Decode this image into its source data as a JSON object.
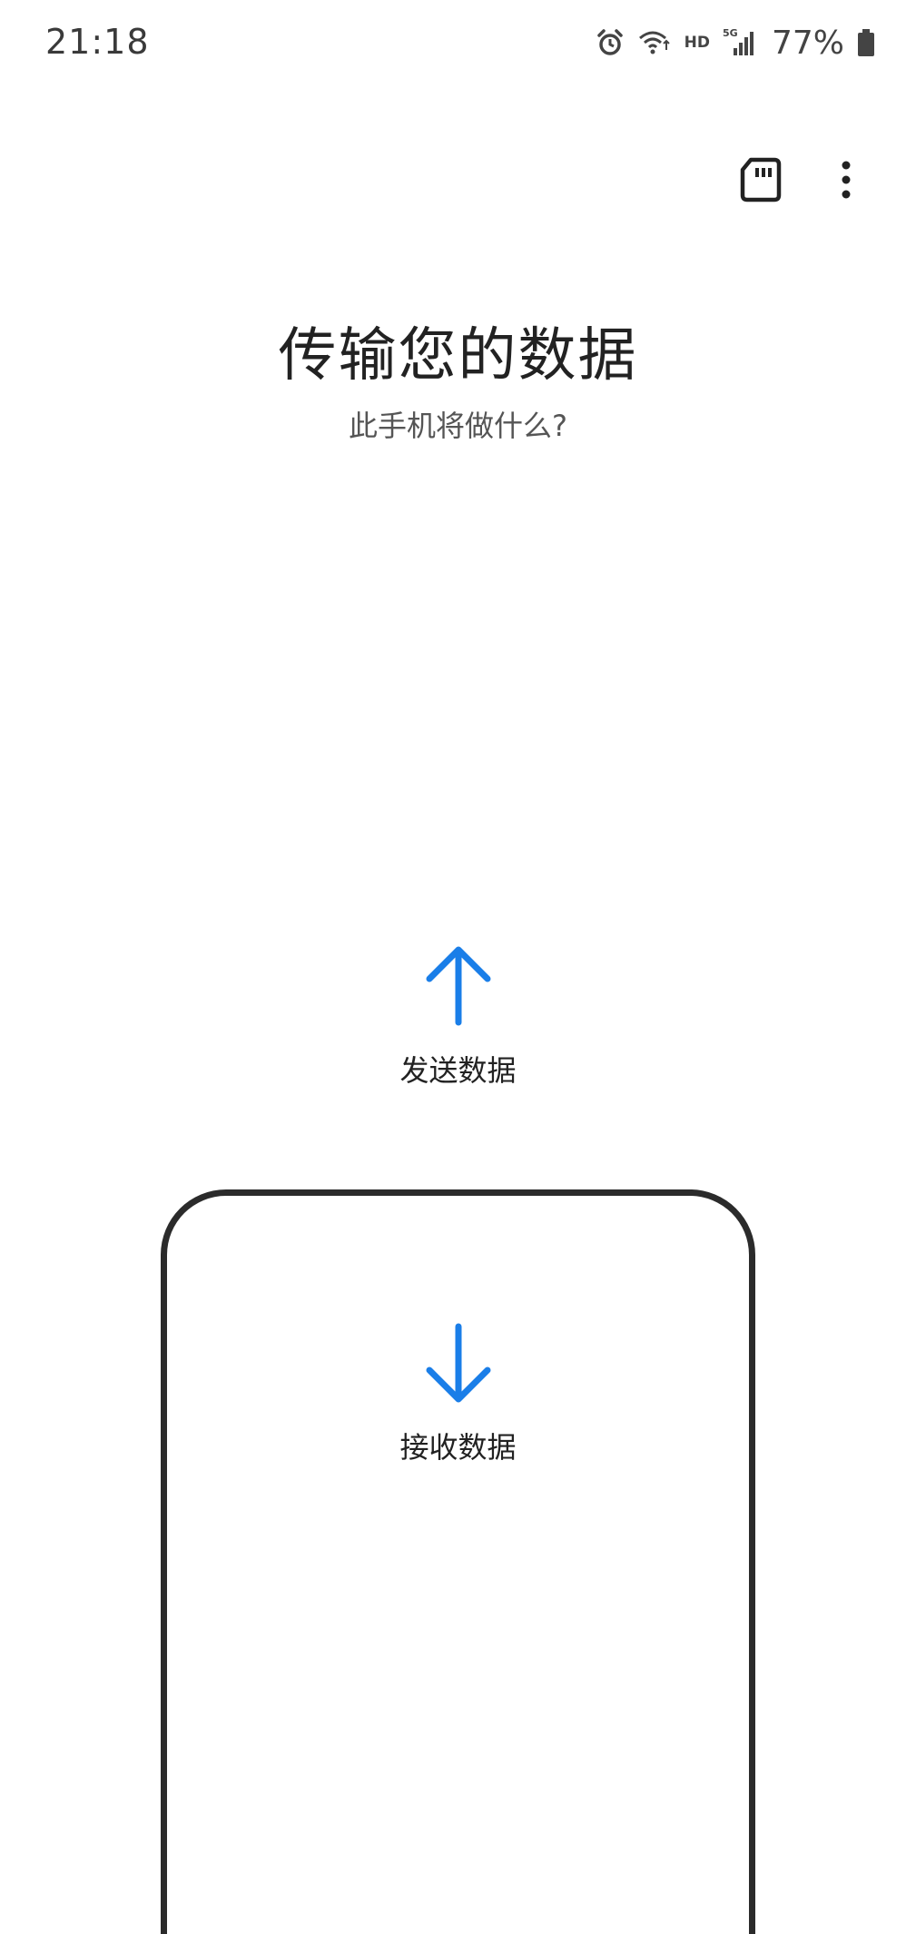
{
  "status_bar": {
    "time": "21:18",
    "hd": "HD",
    "network": "5G",
    "battery": "77%",
    "icons": [
      "alarm-icon",
      "wifi-icon",
      "signal-icon",
      "battery-icon"
    ]
  },
  "toolbar": {
    "icons": [
      "sd-card-icon",
      "more-options-icon"
    ]
  },
  "header": {
    "title": "传输您的数据",
    "subtitle": "此手机将做什么?"
  },
  "options": {
    "send": {
      "label": "发送数据",
      "icon": "arrow-up-icon"
    },
    "receive": {
      "label": "接收数据",
      "icon": "arrow-down-icon"
    }
  },
  "colors": {
    "accent": "#1a7ee8",
    "outline": "#2b2b2b",
    "text": "#222222"
  }
}
